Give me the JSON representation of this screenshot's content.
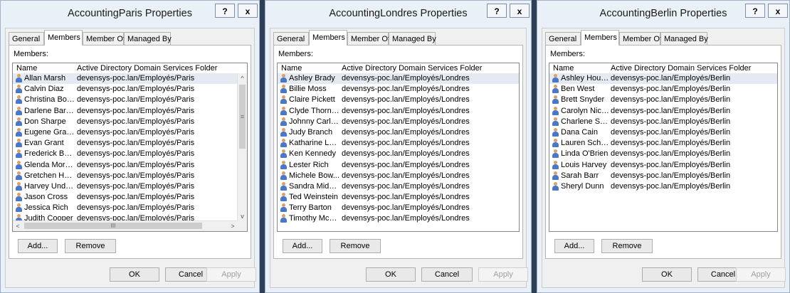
{
  "window_buttons": {
    "help": "?",
    "close": "x"
  },
  "tabs": [
    "General",
    "Members",
    "Member Of",
    "Managed By"
  ],
  "members_label": "Members:",
  "columns": {
    "name": "Name",
    "folder": "Active Directory Domain Services Folder"
  },
  "buttons": {
    "add": "Add...",
    "remove": "Remove",
    "ok": "OK",
    "cancel": "Cancel",
    "apply": "Apply"
  },
  "scroll_glyphs": {
    "up": "^",
    "down": "v",
    "left": "<",
    "right": ">",
    "thumb_v": "≡",
    "thumb_h": "III"
  },
  "dialogs": [
    {
      "title": "AccountingParis Properties",
      "members": [
        {
          "name": "Allan Marsh",
          "folder": "devensys-poc.lan/Employés/Paris"
        },
        {
          "name": "Calvin Diaz",
          "folder": "devensys-poc.lan/Employés/Paris"
        },
        {
          "name": "Christina Bow...",
          "folder": "devensys-poc.lan/Employés/Paris"
        },
        {
          "name": "Darlene Barton",
          "folder": "devensys-poc.lan/Employés/Paris"
        },
        {
          "name": "Don Sharpe",
          "folder": "devensys-poc.lan/Employés/Paris"
        },
        {
          "name": "Eugene Grah...",
          "folder": "devensys-poc.lan/Employés/Paris"
        },
        {
          "name": "Evan Grant",
          "folder": "devensys-poc.lan/Employés/Paris"
        },
        {
          "name": "Frederick Baker",
          "folder": "devensys-poc.lan/Employés/Paris"
        },
        {
          "name": "Glenda Morgan",
          "folder": "devensys-poc.lan/Employés/Paris"
        },
        {
          "name": "Gretchen Hol...",
          "folder": "devensys-poc.lan/Employés/Paris"
        },
        {
          "name": "Harvey Under...",
          "folder": "devensys-poc.lan/Employés/Paris"
        },
        {
          "name": "Jason Cross",
          "folder": "devensys-poc.lan/Employés/Paris"
        },
        {
          "name": "Jessica Rich",
          "folder": "devensys-poc.lan/Employés/Paris"
        },
        {
          "name": "Judith Cooper",
          "folder": "devensys-poc.lan/Employés/Paris"
        }
      ]
    },
    {
      "title": "AccountingLondres Properties",
      "members": [
        {
          "name": "Ashley Brady",
          "folder": "devensys-poc.lan/Employés/Londres"
        },
        {
          "name": "Billie Moss",
          "folder": "devensys-poc.lan/Employés/Londres"
        },
        {
          "name": "Claire Pickett",
          "folder": "devensys-poc.lan/Employés/Londres"
        },
        {
          "name": "Clyde Thornton",
          "folder": "devensys-poc.lan/Employés/Londres"
        },
        {
          "name": "Johnny Carlton",
          "folder": "devensys-poc.lan/Employés/Londres"
        },
        {
          "name": "Judy Branch",
          "folder": "devensys-poc.lan/Employés/Londres"
        },
        {
          "name": "Katharine Luc...",
          "folder": "devensys-poc.lan/Employés/Londres"
        },
        {
          "name": "Ken Kennedy",
          "folder": "devensys-poc.lan/Employés/Londres"
        },
        {
          "name": "Lester Rich",
          "folder": "devensys-poc.lan/Employés/Londres"
        },
        {
          "name": "Michele Bow...",
          "folder": "devensys-poc.lan/Employés/Londres"
        },
        {
          "name": "Sandra Middl...",
          "folder": "devensys-poc.lan/Employés/Londres"
        },
        {
          "name": "Ted Weinstein",
          "folder": "devensys-poc.lan/Employés/Londres"
        },
        {
          "name": "Terry Barton",
          "folder": "devensys-poc.lan/Employés/Londres"
        },
        {
          "name": "Timothy McNeill",
          "folder": "devensys-poc.lan/Employés/Londres"
        }
      ]
    },
    {
      "title": "AccountingBerlin Properties",
      "members": [
        {
          "name": "Ashley Houston",
          "folder": "devensys-poc.lan/Employés/Berlin"
        },
        {
          "name": "Ben West",
          "folder": "devensys-poc.lan/Employés/Berlin"
        },
        {
          "name": "Brett Snyder",
          "folder": "devensys-poc.lan/Employés/Berlin"
        },
        {
          "name": "Carolyn Nichols",
          "folder": "devensys-poc.lan/Employés/Berlin"
        },
        {
          "name": "Charlene Stev...",
          "folder": "devensys-poc.lan/Employés/Berlin"
        },
        {
          "name": "Dana Cain",
          "folder": "devensys-poc.lan/Employés/Berlin"
        },
        {
          "name": "Lauren Schultz",
          "folder": "devensys-poc.lan/Employés/Berlin"
        },
        {
          "name": "Linda O'Brien",
          "folder": "devensys-poc.lan/Employés/Berlin"
        },
        {
          "name": "Louis Harvey",
          "folder": "devensys-poc.lan/Employés/Berlin"
        },
        {
          "name": "Sarah Barr",
          "folder": "devensys-poc.lan/Employés/Berlin"
        },
        {
          "name": "Sheryl Dunn",
          "folder": "devensys-poc.lan/Employés/Berlin"
        }
      ]
    }
  ]
}
